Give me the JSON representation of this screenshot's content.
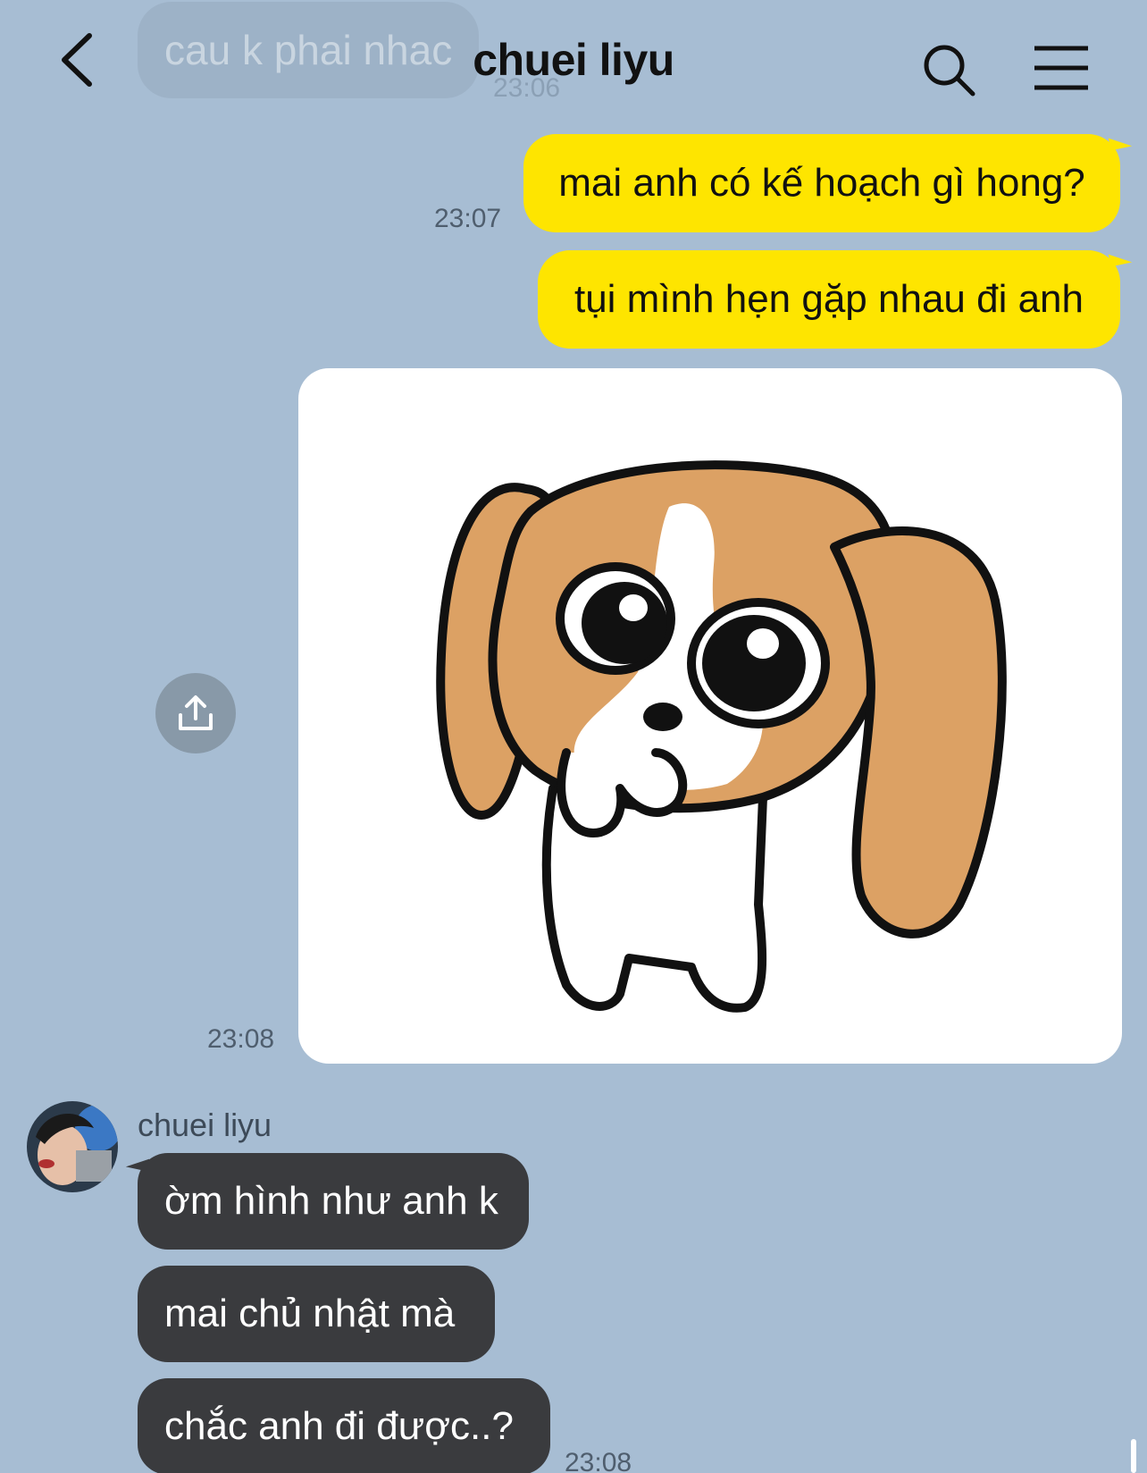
{
  "header": {
    "title": "chuei liyu",
    "back_icon": "chevron-left-icon",
    "search_icon": "search-icon",
    "menu_icon": "hamburger-menu-icon"
  },
  "previous_message": {
    "text": "cau k phai nhac",
    "time": "23:06"
  },
  "outgoing": {
    "messages": [
      "mai anh có kế hoạch gì hong?",
      "tụi mình hẹn gặp nhau đi anh"
    ],
    "time": "23:07",
    "sticker_time": "23:08",
    "sticker_subject": "puppy-sticker",
    "share_icon": "share-upload-icon"
  },
  "incoming": {
    "sender": "chuei liyu",
    "messages": [
      "ờm hình như anh k",
      "mai chủ nhật mà",
      "chắc anh đi được..?"
    ],
    "time": "23:08"
  },
  "colors": {
    "background": "#a7bdd3",
    "outgoing_bubble": "#fee500",
    "incoming_bubble": "#3a3b3e",
    "share_button": "#8899a8"
  }
}
